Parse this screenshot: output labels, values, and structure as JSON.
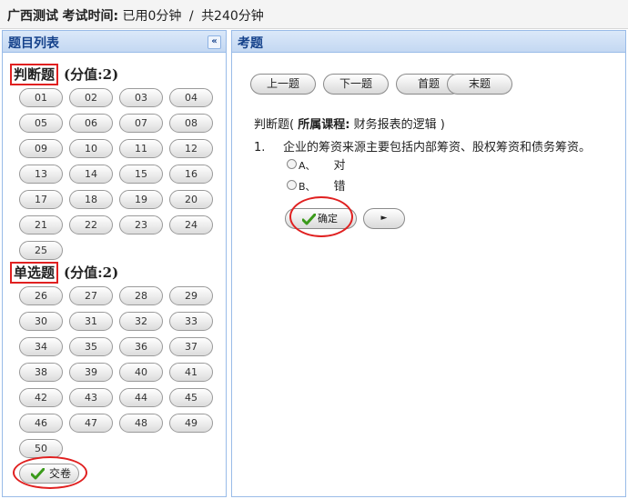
{
  "topbar": {
    "exam_name": "广西测试",
    "time_label": "考试时间:",
    "used": "已用0分钟",
    "separator": "/",
    "total": "共240分钟"
  },
  "left_panel": {
    "title": "题目列表",
    "collapse_icon": "«",
    "sections": [
      {
        "name": "判断题",
        "score": "(分值:2)",
        "questions": [
          "01",
          "02",
          "03",
          "04",
          "05",
          "06",
          "07",
          "08",
          "09",
          "10",
          "11",
          "12",
          "13",
          "14",
          "15",
          "16",
          "17",
          "18",
          "19",
          "20",
          "21",
          "22",
          "23",
          "24",
          "25"
        ]
      },
      {
        "name": "单选题",
        "score": "(分值:2)",
        "questions": [
          "26",
          "27",
          "28",
          "29",
          "30",
          "31",
          "32",
          "33",
          "34",
          "35",
          "36",
          "37",
          "38",
          "39",
          "40",
          "41",
          "42",
          "43",
          "44",
          "45",
          "46",
          "47",
          "48",
          "49",
          "50"
        ]
      }
    ],
    "submit_label": "交卷"
  },
  "right_panel": {
    "title": "考题",
    "nav": [
      "上一题",
      "下一题",
      "首题",
      "末题"
    ],
    "question_type": "判断题",
    "course_label": "所属课程:",
    "course_name": "财务报表的逻辑",
    "question_number": "1.",
    "question_text": "企业的筹资来源主要包括内部筹资、股权筹资和债务筹资。",
    "options": [
      {
        "letter": "A、",
        "text": "对"
      },
      {
        "letter": "B、",
        "text": "错"
      }
    ],
    "confirm_label": "确定",
    "next_arrow": "►"
  },
  "colors": {
    "panel_border": "#99bbe8",
    "panel_header_text": "#15428b",
    "annotation_red": "#e02020",
    "check_green": "#3a9a1a"
  },
  "icons": {
    "collapse": "double-chevron-left-icon",
    "submit": "green-check-icon",
    "confirm": "green-check-icon",
    "next": "play-triangle-icon"
  }
}
